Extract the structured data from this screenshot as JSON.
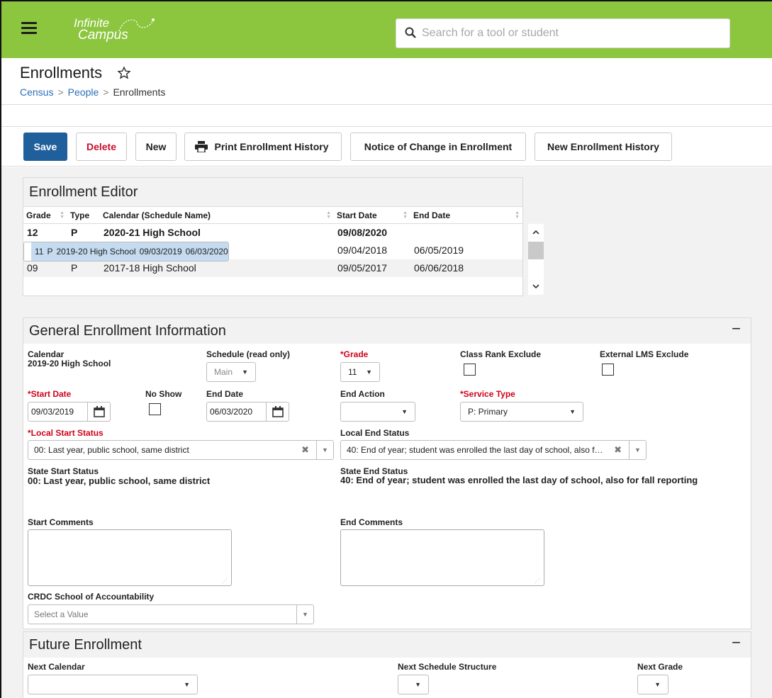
{
  "app": {
    "logo_line1": "Infinite",
    "logo_line2": "Campus",
    "search_placeholder": "Search for a tool or student",
    "brand_color": "#8cc63f"
  },
  "page": {
    "title": "Enrollments",
    "breadcrumb": [
      "Census",
      "People",
      "Enrollments"
    ]
  },
  "toolbar": {
    "save": "Save",
    "delete": "Delete",
    "new": "New",
    "print_history": "Print Enrollment History",
    "notice": "Notice of Change in Enrollment",
    "new_history": "New Enrollment History"
  },
  "editor": {
    "title": "Enrollment Editor",
    "columns": [
      "Grade",
      "Type",
      "Calendar (Schedule Name)",
      "Start Date",
      "End Date"
    ],
    "rows": [
      {
        "grade": "12",
        "type": "P",
        "calendar": "2020-21 High School",
        "start": "09/08/2020",
        "end": ""
      },
      {
        "grade": "11",
        "type": "P",
        "calendar": "2019-20 High School",
        "start": "09/03/2019",
        "end": "06/03/2020"
      },
      {
        "grade": "10",
        "type": "P",
        "calendar": "2018-19 High School",
        "start": "09/04/2018",
        "end": "06/05/2019"
      },
      {
        "grade": "09",
        "type": "P",
        "calendar": "2017-18 High School",
        "start": "09/05/2017",
        "end": "06/06/2018"
      }
    ]
  },
  "general": {
    "title": "General Enrollment Information",
    "calendar_label": "Calendar",
    "calendar_value": "2019-20 High School",
    "schedule_label": "Schedule (read only)",
    "schedule_value": "Main",
    "grade_label": "*Grade",
    "grade_value": "11",
    "class_rank_label": "Class Rank Exclude",
    "lms_label": "External LMS Exclude",
    "start_date_label": "*Start Date",
    "start_date_value": "09/03/2019",
    "no_show_label": "No Show",
    "end_date_label": "End Date",
    "end_date_value": "06/03/2020",
    "end_action_label": "End Action",
    "service_type_label": "*Service Type",
    "service_type_value": "P: Primary",
    "local_start_label": "*Local Start Status",
    "local_start_value": "00: Last year, public school, same district",
    "local_end_label": "Local End Status",
    "local_end_value": "40: End of year; student was enrolled the last day of school, also for fall reporting",
    "state_start_label": "State Start Status",
    "state_start_value": "00: Last year, public school, same district",
    "state_end_label": "State End Status",
    "state_end_value": "40: End of year; student was enrolled the last day of school, also for fall reporting",
    "start_comments_label": "Start Comments",
    "end_comments_label": "End Comments",
    "crdc_label": "CRDC School of Accountability",
    "crdc_placeholder": "Select a Value"
  },
  "future": {
    "title": "Future Enrollment",
    "next_calendar_label": "Next Calendar",
    "next_schedule_label": "Next Schedule Structure",
    "next_grade_label": "Next Grade"
  }
}
